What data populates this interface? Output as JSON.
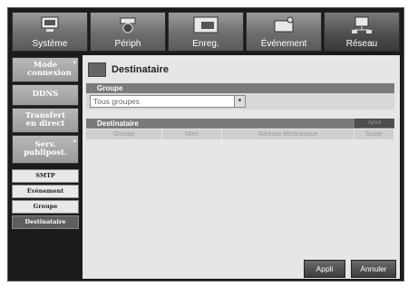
{
  "tabs": [
    {
      "label": "Système",
      "icon": "system-icon"
    },
    {
      "label": "Périph",
      "icon": "camera-icon"
    },
    {
      "label": "Enreg.",
      "icon": "record-icon"
    },
    {
      "label": "Événement",
      "icon": "event-icon"
    },
    {
      "label": "Réseau",
      "icon": "network-icon"
    }
  ],
  "sidebar": {
    "items": [
      {
        "label": "Mode connexion"
      },
      {
        "label": "DDNS"
      },
      {
        "label": "Transfert en direct"
      },
      {
        "label": "Serv. publipost."
      }
    ],
    "sub_items": [
      {
        "label": "SMTP"
      },
      {
        "label": "Événement"
      },
      {
        "label": "Groupe"
      },
      {
        "label": "Destinataire"
      }
    ]
  },
  "main": {
    "title": "Destinataire",
    "group_section": {
      "header": "Groupe",
      "dropdown_value": "Tous groupes"
    },
    "recipient_section": {
      "header": "Destinataire",
      "add_button": "Ajout",
      "columns": [
        "Groupe",
        "Nom",
        "Adresse électronique",
        "Suppr"
      ]
    },
    "buttons": {
      "apply": "Appli",
      "cancel": "Annuler"
    }
  }
}
